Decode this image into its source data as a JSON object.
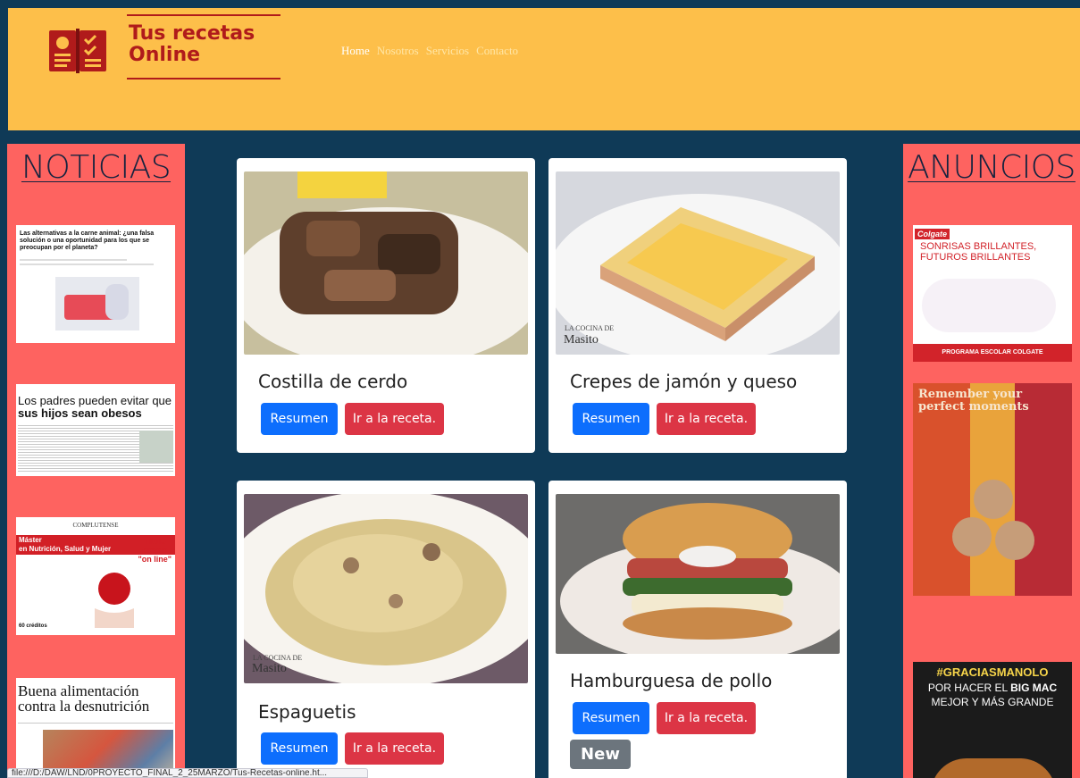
{
  "header": {
    "logo_line1": "Tus recetas",
    "logo_line2": "Online",
    "nav": [
      "Home",
      "Nosotros",
      "Servicios",
      "Contacto"
    ]
  },
  "left_sidebar": {
    "title": "NOTICIAS",
    "news": [
      {
        "headline": "Las alternativas a la carne animal: ¿una falsa solución o una oportunidad para los que se preocupan por el planeta?"
      },
      {
        "headline_a": "Los padres pueden evitar que",
        "headline_b": "sus hijos sean obesos"
      },
      {
        "brand": "COMPLUTENSE",
        "title_a": "Máster",
        "title_b": "en Nutrición, Salud y Mujer",
        "side_a": "Título",
        "side_b": "propio",
        "side_c": "\"on line\"",
        "credits": "60 créditos"
      },
      {
        "headline_a": "Buena alimentación",
        "headline_b": "contra la desnutrición"
      }
    ]
  },
  "right_sidebar": {
    "title": "ANUNCIOS",
    "ads": [
      {
        "brand": "Colgate",
        "line1": "SONRISAS BRILLANTES,",
        "line2": "FUTUROS BRILLANTES",
        "footer": "PROGRAMA ESCOLAR COLGATE"
      },
      {
        "line1": "Remember your",
        "line2": "perfect moments"
      },
      {
        "line1": "#GRACIASMANOLO",
        "line2_a": "POR HACER EL ",
        "line2_b": "BIG MAC",
        "line3": "MEJOR Y MÁS GRANDE"
      }
    ]
  },
  "recipes": [
    {
      "title": "Costilla de cerdo",
      "summary_label": "Resumen",
      "recipe_label": "Ir a la receta."
    },
    {
      "title": "Crepes de jamón y queso",
      "summary_label": "Resumen",
      "recipe_label": "Ir a la receta.",
      "watermark_a": "LA COCINA DE",
      "watermark_b": "Masito"
    },
    {
      "title": "Espaguetis",
      "summary_label": "Resumen",
      "recipe_label": "Ir a la receta.",
      "watermark_a": "LA COCINA DE",
      "watermark_b": "Masito"
    },
    {
      "title": "Hamburguesa de pollo",
      "summary_label": "Resumen",
      "recipe_label": "Ir a la receta.",
      "badge": "New"
    }
  ],
  "statusbar": {
    "url": "file:///D:/DAW/LND/0PROYECTO_FINAL_2_25MARZO/Tus-Recetas-online.ht..."
  },
  "colors": {
    "header_bg": "#fdbf4a",
    "page_bg": "#0f3a57",
    "sidebar_bg": "#fe6360",
    "logo": "#b01b1b",
    "primary": "#0d6efd",
    "danger": "#dc3545",
    "secondary": "#6c757d"
  }
}
